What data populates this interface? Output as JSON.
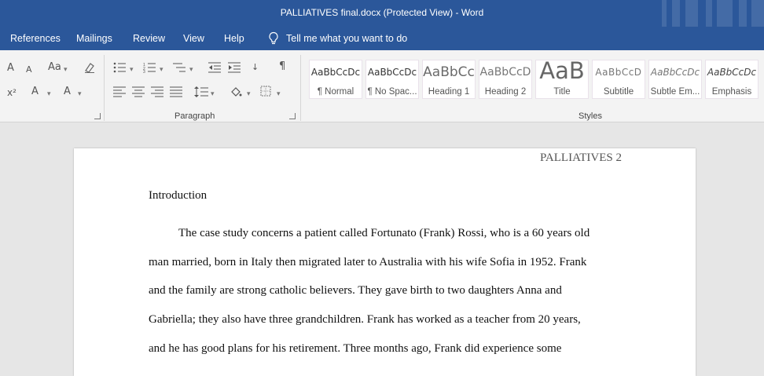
{
  "window": {
    "title": "PALLIATIVES final.docx (Protected View)  -  Word"
  },
  "menu": {
    "tabs": [
      "References",
      "Mailings",
      "Review",
      "View",
      "Help"
    ],
    "tell_me": "Tell me what you want to do"
  },
  "ribbon": {
    "groups": {
      "paragraph": "Paragraph",
      "styles": "Styles"
    },
    "font_icons": {
      "grow": "A",
      "shrink": "A",
      "change_case": "Aa",
      "subscript": "x²",
      "text_effects": "A",
      "font_color": "A"
    },
    "styles": [
      {
        "sample": "AaBbCcDc",
        "name": "¶ Normal"
      },
      {
        "sample": "AaBbCcDc",
        "name": "¶ No Spac..."
      },
      {
        "sample": "AaBbCc",
        "name": "Heading 1"
      },
      {
        "sample": "AaBbCcD",
        "name": "Heading 2"
      },
      {
        "sample": "AaB",
        "name": "Title"
      },
      {
        "sample": "AaBbCcD",
        "name": "Subtitle"
      },
      {
        "sample": "AaBbCcDc",
        "name": "Subtle Em..."
      },
      {
        "sample": "AaBbCcDc",
        "name": "Emphasis"
      }
    ]
  },
  "document": {
    "header": "PALLIATIVES 2",
    "heading": "Introduction",
    "lines": [
      "The case study concerns a patient called Fortunato (Frank) Rossi, who is a 60 years old",
      "man married, born in Italy then migrated later to Australia with his wife Sofia in 1952. Frank",
      "and the family are strong catholic believers. They gave birth to two daughters Anna and",
      "Gabriella; they also have three grandchildren. Frank has worked as a teacher from 20 years,",
      "and he has good plans for his retirement. Three months ago, Frank did experience some"
    ]
  },
  "colors": {
    "accent": "#2b579a",
    "ribbon": "#f3f3f3",
    "canvas": "#e6e6e6"
  }
}
